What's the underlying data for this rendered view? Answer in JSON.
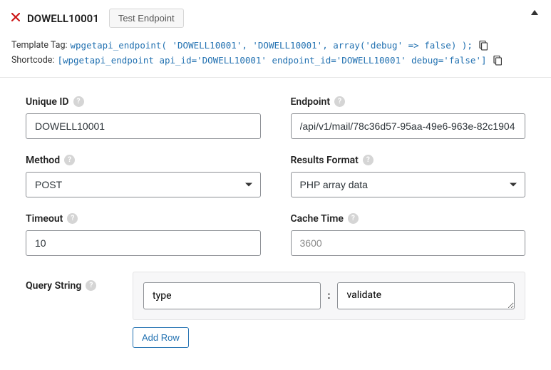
{
  "header": {
    "title": "DOWELL10001",
    "test_btn": "Test Endpoint"
  },
  "tags": {
    "template_label": "Template Tag:",
    "template_code": "wpgetapi_endpoint( 'DOWELL10001', 'DOWELL10001', array('debug' => false) );",
    "shortcode_label": "Shortcode:",
    "shortcode_code": "[wpgetapi_endpoint api_id='DOWELL10001' endpoint_id='DOWELL10001' debug='false']"
  },
  "fields": {
    "unique_id": {
      "label": "Unique ID",
      "value": "DOWELL10001"
    },
    "endpoint": {
      "label": "Endpoint",
      "value": "/api/v1/mail/78c36d57-95aa-49e6-963e-82c1904"
    },
    "method": {
      "label": "Method",
      "value": "POST"
    },
    "results_format": {
      "label": "Results Format",
      "value": "PHP array data"
    },
    "timeout": {
      "label": "Timeout",
      "value": "10"
    },
    "cache_time": {
      "label": "Cache Time",
      "placeholder": "3600"
    }
  },
  "query_string": {
    "label": "Query String",
    "rows": [
      {
        "key": "type",
        "value": "validate"
      }
    ],
    "add_row_label": "Add Row"
  },
  "glyphs": {
    "help": "?",
    "colon": ":"
  }
}
